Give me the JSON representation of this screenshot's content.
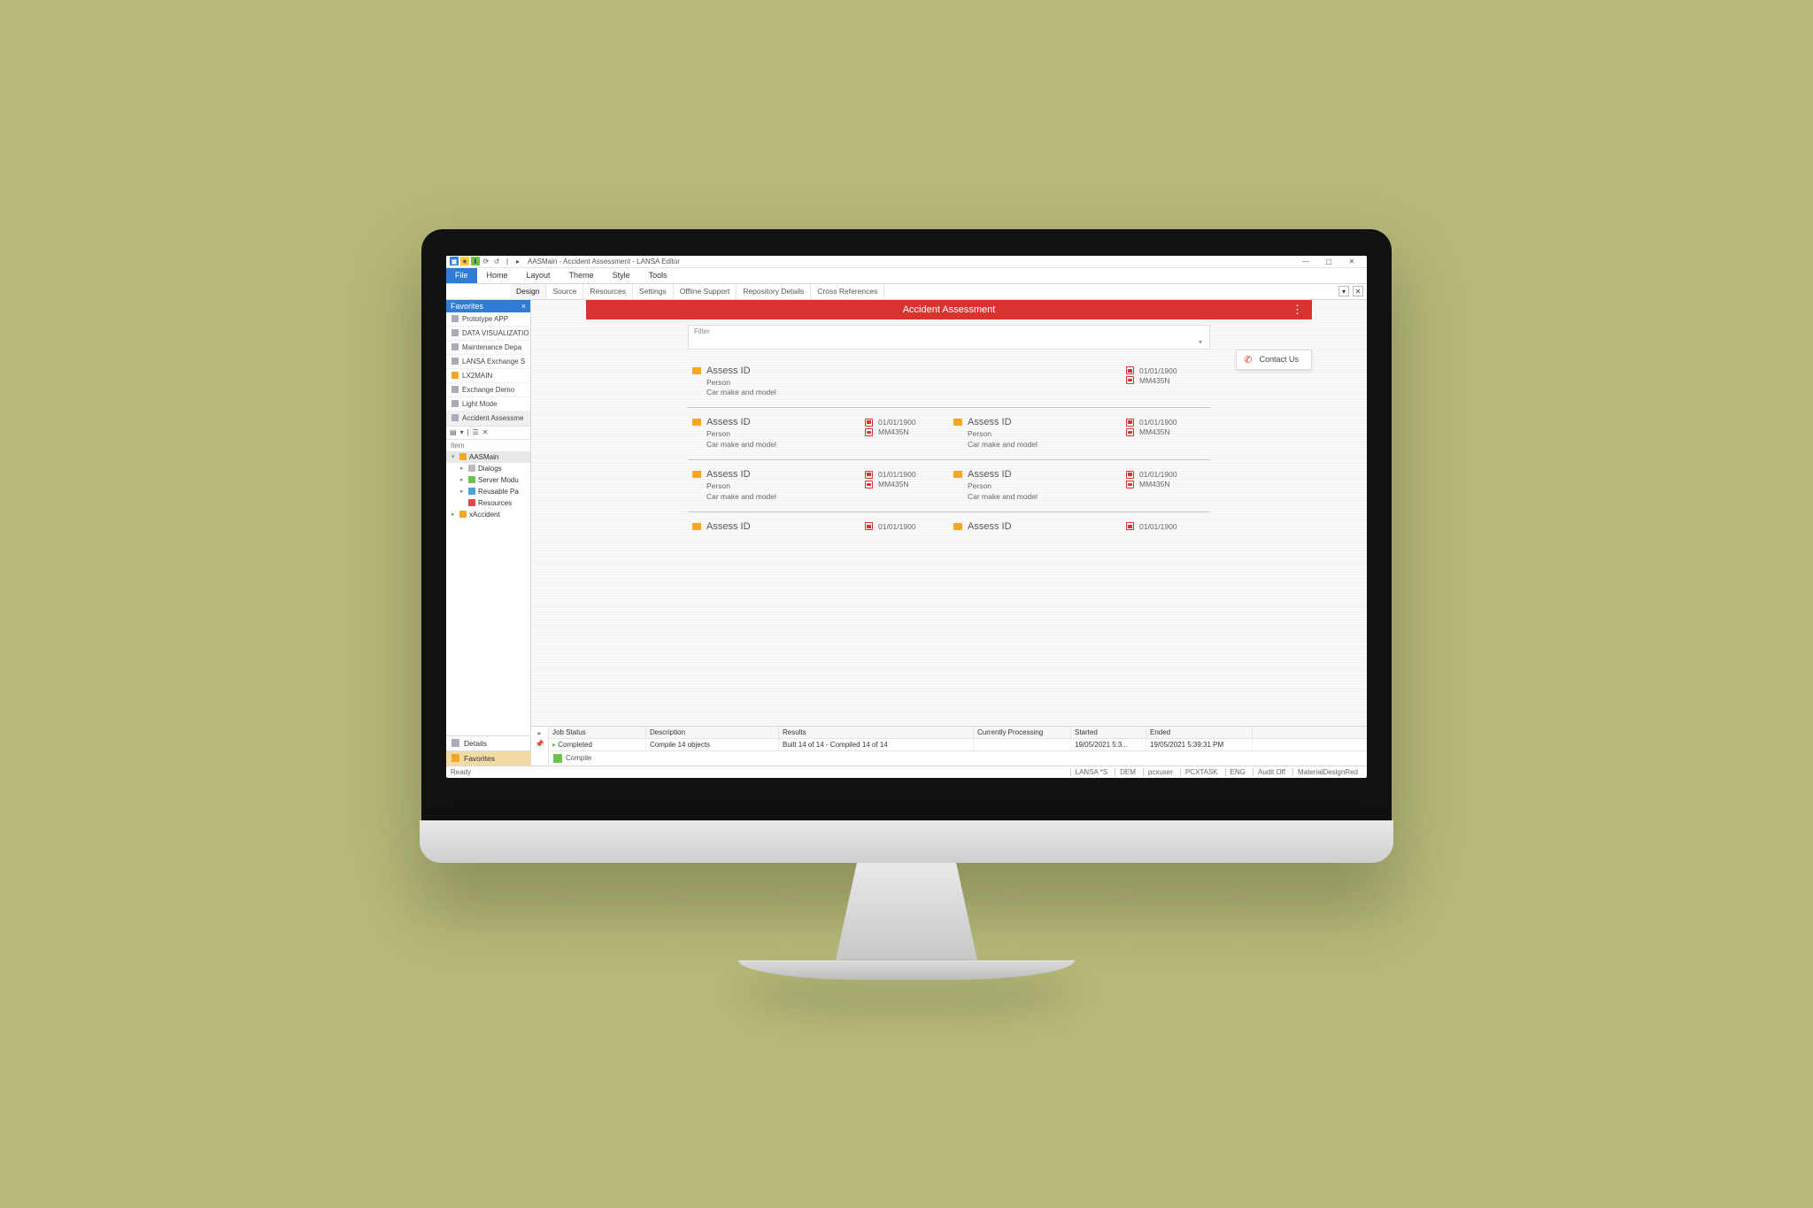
{
  "window": {
    "title": "AASMain - Accident Assessment - LANSA Editor",
    "min": "—",
    "max": "▢",
    "close": "✕"
  },
  "menubar": [
    "File",
    "Home",
    "Layout",
    "Theme",
    "Style",
    "Tools"
  ],
  "subtabs": [
    "Design",
    "Source",
    "Resources",
    "Settings",
    "Offline Support",
    "Repository Details",
    "Cross References"
  ],
  "favorites": {
    "header": "Favorites",
    "close_x": "×",
    "items": [
      "Prototype APP",
      "DATA VISUALIZATIO",
      "Maintenance Depa",
      "LANSA Exchange S",
      "LX2MAIN",
      "Exchange Demo",
      "Light Mode",
      "Accident Assessme"
    ]
  },
  "tree": {
    "header": "Item",
    "root": "AASMain",
    "children": [
      {
        "label": "Dialogs",
        "color": "grey"
      },
      {
        "label": "Server Modu",
        "color": "green"
      },
      {
        "label": "Reusable Pa",
        "color": "blue"
      },
      {
        "label": "Resources",
        "color": "red"
      }
    ],
    "sibling": {
      "label": "xAccident",
      "color": "orange"
    }
  },
  "bottom_tabs": {
    "details": "Details",
    "favorites": "Favorites"
  },
  "app": {
    "title": "Accident Assessment",
    "filter_label": "Filter",
    "contact": "Contact Us"
  },
  "card": {
    "title": "Assess ID",
    "person": "Person",
    "carmake": "Car make and model",
    "date": "01/01/1900",
    "rego": "MM435N"
  },
  "job": {
    "headers": [
      "Job Status",
      "Description",
      "Results",
      "Currently Processing",
      "Started",
      "Ended"
    ],
    "row": [
      "Completed",
      "Compile 14 objects",
      "Built 14 of 14 - Compiled 14 of 14",
      "",
      "19/05/2021 5:3...",
      "19/05/2021 5:39:31 PM"
    ],
    "compile": "Compile"
  },
  "status": {
    "left": "Ready",
    "right": [
      "LANSA *S",
      "DEM",
      "pcxuser",
      "PCXTASK",
      "ENG",
      "Audit Off",
      "MaterialDesignRed"
    ]
  }
}
